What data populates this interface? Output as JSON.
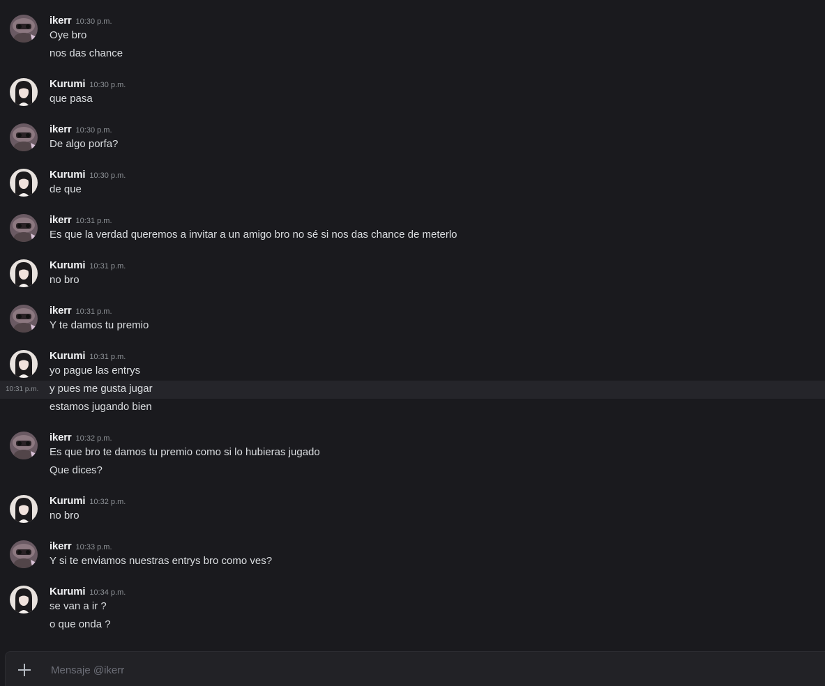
{
  "messages": [
    {
      "author": "ikerr",
      "avatar": "ikerr-avatar",
      "time": "10:30 p.m.",
      "lines": [
        "Oye bro",
        "nos das chance"
      ]
    },
    {
      "author": "Kurumi",
      "avatar": "kurumi-avatar",
      "time": "10:30 p.m.",
      "lines": [
        "que pasa"
      ]
    },
    {
      "author": "ikerr",
      "avatar": "ikerr-avatar",
      "time": "10:30 p.m.",
      "lines": [
        "De algo porfa?"
      ]
    },
    {
      "author": "Kurumi",
      "avatar": "kurumi-avatar",
      "time": "10:30 p.m.",
      "lines": [
        "de que"
      ]
    },
    {
      "author": "ikerr",
      "avatar": "ikerr-avatar",
      "time": "10:31 p.m.",
      "lines": [
        "Es que la verdad queremos a invitar a un amigo bro no sé si nos das chance de meterlo"
      ]
    },
    {
      "author": "Kurumi",
      "avatar": "kurumi-avatar",
      "time": "10:31 p.m.",
      "lines": [
        "no bro"
      ]
    },
    {
      "author": "ikerr",
      "avatar": "ikerr-avatar",
      "time": "10:31 p.m.",
      "lines": [
        "Y te damos tu premio"
      ]
    },
    {
      "author": "Kurumi",
      "avatar": "kurumi-avatar",
      "time": "10:31 p.m.",
      "lines": [
        "yo pague las entrys",
        "y pues me gusta jugar",
        "estamos jugando bien"
      ],
      "hover_line_time": "10:31 p.m."
    },
    {
      "author": "ikerr",
      "avatar": "ikerr-avatar",
      "time": "10:32 p.m.",
      "lines": [
        "Es que bro te damos tu premio como si lo hubieras jugado",
        "Que dices?"
      ]
    },
    {
      "author": "Kurumi",
      "avatar": "kurumi-avatar",
      "time": "10:32 p.m.",
      "lines": [
        "no bro"
      ]
    },
    {
      "author": "ikerr",
      "avatar": "ikerr-avatar",
      "time": "10:33 p.m.",
      "lines": [
        "Y si te enviamos nuestras entrys bro como ves?"
      ]
    },
    {
      "author": "Kurumi",
      "avatar": "kurumi-avatar",
      "time": "10:34 p.m.",
      "lines": [
        "se van a ir ?",
        "o que onda ?"
      ]
    }
  ],
  "composer": {
    "placeholder": "Mensaje @ikerr",
    "add_icon": "plus-icon"
  },
  "colors": {
    "background": "#1a1a1e",
    "username": "#f2f3f5",
    "text": "#dbdee1",
    "timestamp": "#8e9297",
    "hover_row": "#25252a"
  }
}
